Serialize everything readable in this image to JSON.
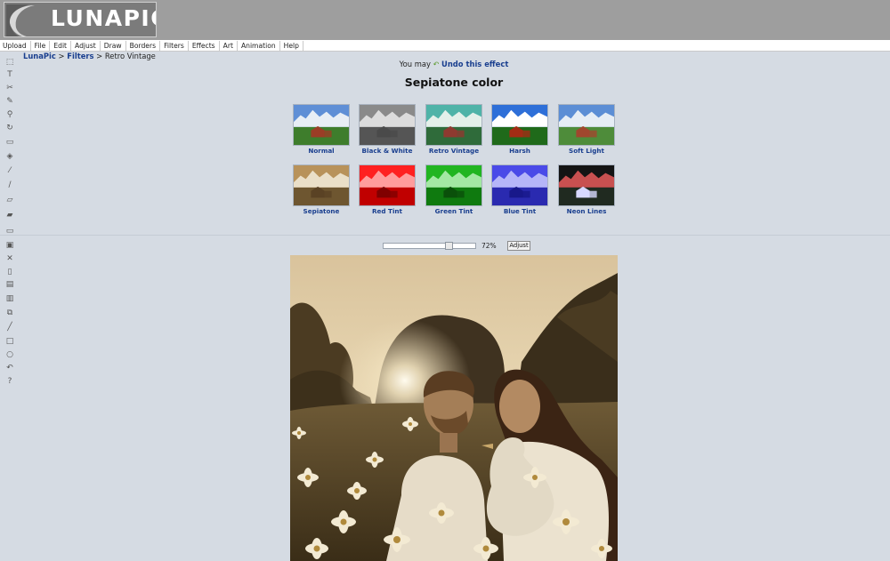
{
  "app": {
    "logo_text": "LUNAPIC"
  },
  "menu": [
    "Upload",
    "File",
    "Edit",
    "Adjust",
    "Draw",
    "Borders",
    "Filters",
    "Effects",
    "Art",
    "Animation",
    "Help"
  ],
  "toolbar": [
    {
      "name": "select-icon",
      "glyph": "⬚"
    },
    {
      "name": "text-icon",
      "glyph": "T"
    },
    {
      "name": "scissors-icon",
      "glyph": "✂"
    },
    {
      "name": "pencil-icon",
      "glyph": "✎"
    },
    {
      "name": "zoom-icon",
      "glyph": "⚲"
    },
    {
      "name": "rotate-icon",
      "glyph": "↻"
    },
    {
      "name": "crop-icon",
      "glyph": "▭"
    },
    {
      "name": "paint-bucket-icon",
      "glyph": "◈"
    },
    {
      "name": "eyedropper-icon",
      "glyph": "⁄"
    },
    {
      "name": "brush-icon",
      "glyph": "∕"
    },
    {
      "name": "open-folder-icon",
      "glyph": "▱"
    },
    {
      "name": "eraser-icon",
      "glyph": "▰"
    },
    {
      "name": "folder-icon",
      "glyph": "▭"
    },
    {
      "name": "save-icon",
      "glyph": "▣"
    },
    {
      "name": "close-icon",
      "glyph": "✕"
    },
    {
      "name": "document-icon",
      "glyph": "▯"
    },
    {
      "name": "print-icon",
      "glyph": "▤"
    },
    {
      "name": "layers-icon",
      "glyph": "▥"
    },
    {
      "name": "copy-icon",
      "glyph": "⧉"
    },
    {
      "name": "line-icon",
      "glyph": "╱"
    },
    {
      "name": "rectangle-icon",
      "glyph": "□"
    },
    {
      "name": "circle-icon",
      "glyph": "○"
    },
    {
      "name": "undo-icon",
      "glyph": "↶"
    },
    {
      "name": "help-icon",
      "glyph": "?"
    }
  ],
  "breadcrumb": {
    "home": "LunaPic",
    "sep1": " > ",
    "section": "Filters",
    "sep2": " > ",
    "current": "Retro Vintage"
  },
  "undo": {
    "prefix": "You may ",
    "icon": "↶",
    "link": "Undo this effect"
  },
  "title": "Sepiatone color",
  "filters": [
    {
      "label": "Normal",
      "sky": "#5f8fd6",
      "mountain": "#e8eef5",
      "ground": "#3e7d2c",
      "barn": "#9b3d26",
      "tint": ""
    },
    {
      "label": "Black & White",
      "sky": "#8a8a8a",
      "mountain": "#dcdcdc",
      "ground": "#555555",
      "barn": "#4a4a4a",
      "tint": ""
    },
    {
      "label": "Retro Vintage",
      "sky": "#4fb3a8",
      "mountain": "#e4f0ea",
      "ground": "#2f6b3a",
      "barn": "#8e3a30",
      "tint": ""
    },
    {
      "label": "Harsh",
      "sky": "#2e6fd8",
      "mountain": "#ffffff",
      "ground": "#1f6a1a",
      "barn": "#a22c14",
      "tint": ""
    },
    {
      "label": "Soft Light",
      "sky": "#5c8ed5",
      "mountain": "#e6edf5",
      "ground": "#4e8c3a",
      "barn": "#a0472e",
      "tint": ""
    },
    {
      "label": "Sepiatone",
      "sky": "#b8925a",
      "mountain": "#eadfc8",
      "ground": "#6e5630",
      "barn": "#5a4224",
      "tint": ""
    },
    {
      "label": "Red Tint",
      "sky": "#ff2020",
      "mountain": "#ff9c9c",
      "ground": "#c00000",
      "barn": "#800000",
      "tint": ""
    },
    {
      "label": "Green Tint",
      "sky": "#21b521",
      "mountain": "#a3e8a3",
      "ground": "#0f7a0f",
      "barn": "#0a500a",
      "tint": ""
    },
    {
      "label": "Blue Tint",
      "sky": "#4a4ae8",
      "mountain": "#b5b5f8",
      "ground": "#2a2ab0",
      "barn": "#18188a",
      "tint": ""
    },
    {
      "label": "Neon Lines",
      "sky": "#141414",
      "mountain": "#c85050",
      "ground": "#202a20",
      "barn": "#d8d8ff",
      "tint": ""
    }
  ],
  "adjust": {
    "value": 0.72,
    "value_label": "72%",
    "button": "Adjust"
  }
}
